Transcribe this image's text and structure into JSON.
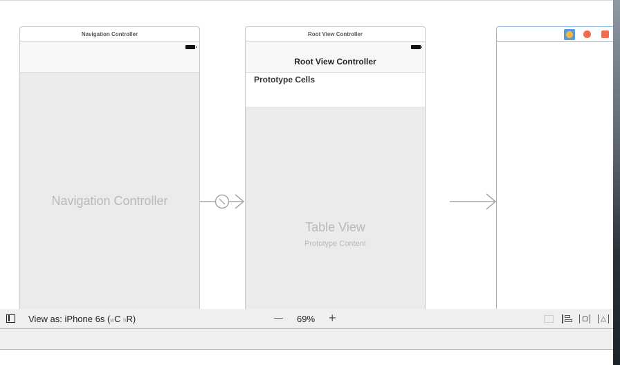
{
  "scenes": [
    {
      "title": "Navigation Controller",
      "placeholder": "Navigation Controller"
    },
    {
      "title": "Root View Controller",
      "nav_title": "Root View Controller",
      "section": "Prototype Cells",
      "placeholder": "Table View",
      "sub_placeholder": "Prototype Content"
    },
    {
      "title": "",
      "icons": [
        "view-controller-icon",
        "first-responder-icon",
        "exit-icon"
      ]
    }
  ],
  "bottom": {
    "view_as": "View as: iPhone 6s (",
    "w": "w",
    "c": "C",
    "h": "h",
    "r": "R",
    "close_paren": ")",
    "zoom_out": "—",
    "zoom": "69%",
    "zoom_in": "+"
  },
  "colors": {
    "selection": "#7fb2e5",
    "vc_icon": "#f5b843",
    "red_icon": "#f26b4e"
  }
}
